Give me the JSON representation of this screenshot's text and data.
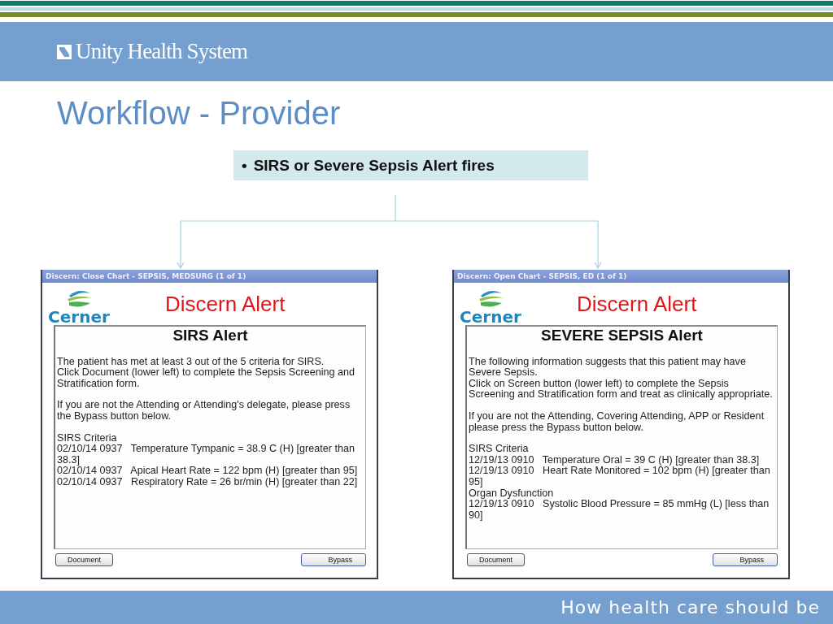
{
  "header": {
    "logo_text": "Unity Health System"
  },
  "slide_title": "Workflow - Provider",
  "callout": {
    "bullet": "•",
    "text": "SIRS or Severe Sepsis Alert fires"
  },
  "dialogs": [
    {
      "title": "Discern: Close Chart - SEPSIS, MEDSURG (1 of 1)",
      "brand": "Cerner",
      "banner": "Discern Alert",
      "heading": "SIRS Alert",
      "blocks": [
        [
          "The patient has met at least 3 out of the 5 criteria for SIRS.",
          "Click Document (lower left) to complete the Sepsis Screening and Stratification form."
        ],
        [
          "If you are not the Attending or Attending's delegate, please press the Bypass button below."
        ],
        [
          "SIRS Criteria",
          "02/10/14 0937   Temperature Tympanic = 38.9 C (H) [greater than 38.3]",
          "02/10/14 0937   Apical Heart Rate = 122 bpm (H) [greater than 95]",
          "02/10/14 0937   Respiratory Rate = 26 br/min (H) [greater than 22]"
        ]
      ],
      "buttons": [
        "Document",
        "Bypass"
      ]
    },
    {
      "title": "Discern: Open Chart - SEPSIS, ED (1 of 1)",
      "brand": "Cerner",
      "banner": "Discern Alert",
      "heading": "SEVERE SEPSIS Alert",
      "blocks": [
        [
          "The following information suggests that this patient may have Severe Sepsis.",
          "Click on Screen button (lower left) to complete the Sepsis Screening and Stratification form and treat as clinically appropriate."
        ],
        [
          "If you are not the Attending, Covering Attending, APP or Resident please press the Bypass button below."
        ],
        [
          "SIRS Criteria",
          "12/19/13 0910   Temperature Oral = 39 C (H) [greater than 38.3]",
          "12/19/13 0910   Heart Rate Monitored = 102 bpm (H) [greater than 95]",
          "Organ Dysfunction",
          "12/19/13 0910   Systolic Blood Pressure = 85 mmHg (L) [less than 90]"
        ]
      ],
      "buttons": [
        "Document",
        "Bypass"
      ]
    }
  ],
  "footer": {
    "tagline": "How health care should be"
  }
}
